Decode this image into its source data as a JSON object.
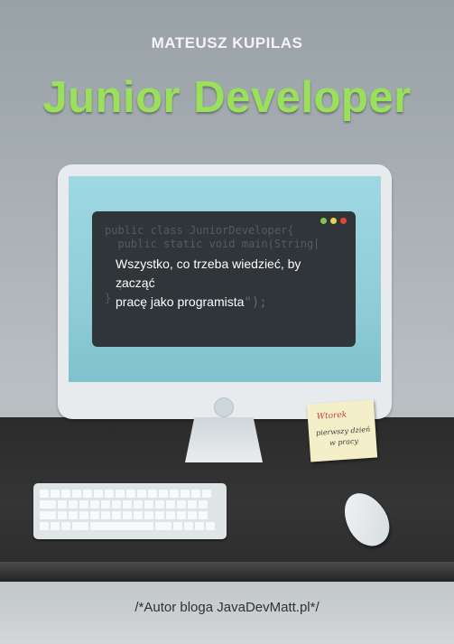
{
  "cover": {
    "author": "MATEUSZ KUPILAS",
    "title": "Junior Developer",
    "code_lines": [
      "public class JuniorDeveloper{",
      "  public static void main(String[",
      "",
      "",
      "  }",
      "}"
    ],
    "tagline_line1": "Wszystko, co trzeba wiedzieć, by zacząć",
    "tagline_line2": "pracę jako programista",
    "tagline_tail": "\");",
    "sticky_note": {
      "head": "Wtorek",
      "line1": "pierwszy dzień",
      "line2": "w pracy"
    },
    "blog": "/*Autor bloga JavaDevMatt.pl*/"
  },
  "colors": {
    "title_green": "#9be05a",
    "terminal_bg": "#2f3538",
    "dot_green": "#7ec850",
    "dot_yellow": "#e8d24a",
    "dot_red": "#e0443b"
  }
}
